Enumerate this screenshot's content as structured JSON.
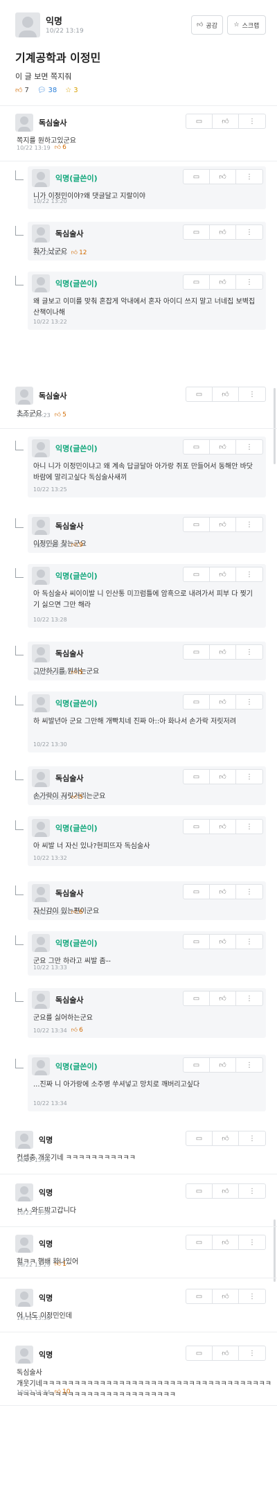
{
  "post": {
    "author": "익명",
    "time": "10/22 13:19",
    "title": "기계공학과 이정민",
    "body": "이 글 보면 쪽지줘",
    "likes": "7",
    "comments": "38",
    "scraps": "3",
    "like_btn": "공감",
    "scrap_btn": "스크랩"
  },
  "comments": [
    {
      "author": "독심술사",
      "text": "쪽지를 원하고있군요",
      "time": "10/22 13:19",
      "likes": "6"
    },
    {
      "author": "익명(글쓴이)",
      "text": "니가 이정민이야?왜 댓글달고 지랄이야",
      "time": "10/22 13:20",
      "likes": ""
    },
    {
      "author": "독심술사",
      "text": "화가 났군요",
      "time": "10/22 13:21",
      "likes": "12"
    },
    {
      "author": "익명(글쓴이)",
      "text": "왜 글보고 이미를 맞춰 혼잡게 악내에서 혼자 아이디 쓰지 말고 너네집 보벽집 산책이나해",
      "time": "10/22 13:22",
      "likes": ""
    },
    {
      "author": "독심술사",
      "text": "초조군요",
      "time": "10/22 13:23",
      "likes": "5"
    },
    {
      "author": "익명(글쓴이)",
      "text": "아니 니가 이정민이냐고 왜 계속 답글달아 아가랑 쥐포 만들어서 동해안 바닷바람에 말리고싶다 독심술사새끼",
      "time": "10/22 13:25",
      "likes": ""
    },
    {
      "author": "독심술사",
      "text": "이정민을 찾는군요",
      "time": "10/22 13:26",
      "likes": "9"
    },
    {
      "author": "익명(글쓴이)",
      "text": "아 독심술사 씨이이발 니 인산통 미끄럼틀에 암흑으로 내려가서 피부 다 찢기기 싫으면 그만 해라",
      "time": "10/22 13:28",
      "likes": ""
    },
    {
      "author": "독심술사",
      "text": "그만하기를 원하는군요",
      "time": "10/22 13:29",
      "likes": "5"
    },
    {
      "author": "익명(글쓴이)",
      "text": "하 씨발년아 군요 그만해 개빡치네 진짜 아::아 화나서 손가락 저릿저려",
      "time": "10/22 13:30",
      "likes": ""
    },
    {
      "author": "독심술사",
      "text": "손가락이 저릿거리는군요",
      "time": "10/22 13:31",
      "likes": "5"
    },
    {
      "author": "익명(글쓴이)",
      "text": "아 씨발 너 자신 있나?현피뜨자 독심술사",
      "time": "10/22 13:32",
      "likes": ""
    },
    {
      "author": "독심술사",
      "text": "자신감이 있는편이군요",
      "time": "10/22 13:32",
      "likes": "6"
    },
    {
      "author": "익명(글쓴이)",
      "text": "군요 그만 하라고 씨발 좀--",
      "time": "10/22 13:33",
      "likes": ""
    },
    {
      "author": "독심술사",
      "text": "군요를 싫어하는군요",
      "time": "10/22 13:34",
      "likes": "6"
    },
    {
      "author": "익명(글쓴이)",
      "text": "...진짜 니 아가랑에 소주병 쑤셔넣고 망치로 깨버리고싶다",
      "time": "10/22 13:34",
      "likes": ""
    },
    {
      "author": "익명",
      "text": "컨셉충 개웃기네 ㅋㅋㅋㅋㅋㅋㅋㅋㅋㅋㅋ",
      "time": "10/22 13:36",
      "likes": ""
    },
    {
      "author": "익명",
      "text": "ㅂㅅ 와드박고갑니다",
      "time": "10/22 13:36",
      "likes": ""
    },
    {
      "author": "익명",
      "text": "헐ㅋㅋ 햄배 화나있어",
      "time": "10/22 13:29",
      "likes": "1"
    },
    {
      "author": "익명",
      "text": "어 나도 이정민인데",
      "time": "10/22 13:30",
      "likes": ""
    },
    {
      "author": "익명",
      "text": "독심술사",
      "text2": "개웃기네ㅋㅋㅋㅋㅋㅋㅋㅋㅋㅋㅋㅋㅋㅋㅋㅋㅋㅋㅋㅋㅋㅋㅋㅋㅋㅋㅋㅋㅋㅋㅋㅋㅋㅋㅋㅋ",
      "text3": "ㅋㅋㅋㅋㅋㅋㅋㅋㅋㅋㅋㅋㅋㅋㅋㅋㅋㅋㅋㅋㅋㅋㅋㅋㅋ",
      "time": "10/22 13:34",
      "likes": "10"
    }
  ],
  "icons": {
    "like": "thumbs-up-icon",
    "comment": "speech-bubble-icon",
    "scrap": "star-icon",
    "more": "kebab-more-icon"
  },
  "colors": {
    "op_author": "#0fa67a",
    "comment_count": "#2b7fd9",
    "scrap_count": "#d8a100",
    "like_count": "#d26a00"
  }
}
